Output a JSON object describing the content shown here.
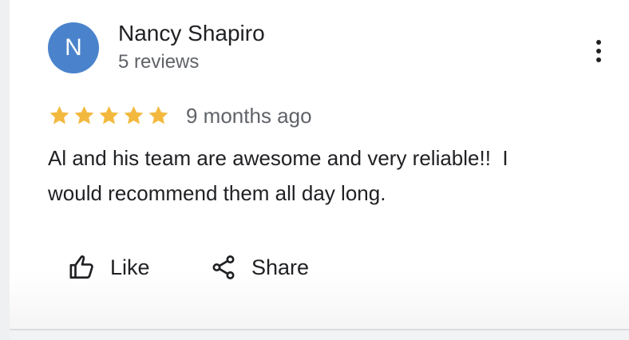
{
  "review": {
    "avatar_initial": "N",
    "avatar_color": "#4a83cc",
    "author_name": "Nancy Shapiro",
    "author_reviews": "5 reviews",
    "rating": 5,
    "rating_max": 5,
    "star_color": "#f3b93f",
    "time_ago": "9 months ago",
    "text_lines": [
      "Al and his team are awesome and very reliable!!  I",
      "would recommend them all day long."
    ]
  },
  "actions": {
    "like_label": "Like",
    "share_label": "Share",
    "like_icon": "thumb-up-icon",
    "share_icon": "share-icon",
    "more_icon": "more-vert-icon"
  }
}
